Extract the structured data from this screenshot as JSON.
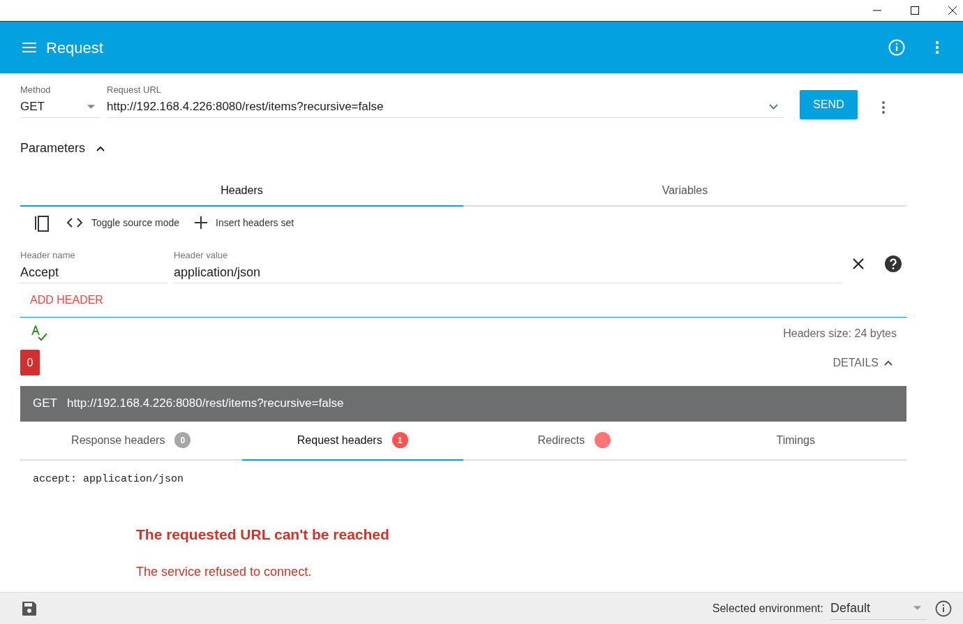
{
  "app_bar": {
    "title": "Request"
  },
  "request": {
    "method_label": "Method",
    "method": "GET",
    "url_label": "Request URL",
    "url": "http://192.168.4.226:8080/rest/items?recursive=false",
    "send_button": "SEND"
  },
  "parameters": {
    "label": "Parameters",
    "expanded": true
  },
  "parameter_tabs": [
    {
      "label": "Headers",
      "selected": true
    },
    {
      "label": "Variables",
      "selected": false
    }
  ],
  "header_actions": [
    {
      "label": "Toggle source mode"
    },
    {
      "label": "Insert headers set"
    }
  ],
  "headers": [
    {
      "name_label": "Header name",
      "name": "Accept",
      "value_label": "Header value",
      "value": "application/json"
    }
  ],
  "add_header_button": "ADD HEADER",
  "headers_size": "Headers size: 24 bytes",
  "status_code": "0",
  "details": {
    "label": "DETAILS",
    "expanded": true
  },
  "request_line": {
    "method": "GET",
    "url": "http://192.168.4.226:8080/rest/items?recursive=false"
  },
  "response_tabs": [
    {
      "label": "Response headers",
      "selected": false,
      "badge": {
        "text": "0",
        "color": "#a6a6a6"
      }
    },
    {
      "label": "Request headers",
      "selected": true,
      "badge": {
        "text": "1",
        "color": "#ff5252"
      }
    },
    {
      "label": "Redirects",
      "selected": false,
      "badge": {
        "color": "#ff7474"
      }
    },
    {
      "label": "Timings",
      "selected": false
    }
  ],
  "response_body": "accept: application/json",
  "error": {
    "title": "The requested URL can't be reached",
    "message": "The service refused to connect."
  },
  "footer": {
    "environment_label": "Selected environment:",
    "environment": "Default"
  }
}
